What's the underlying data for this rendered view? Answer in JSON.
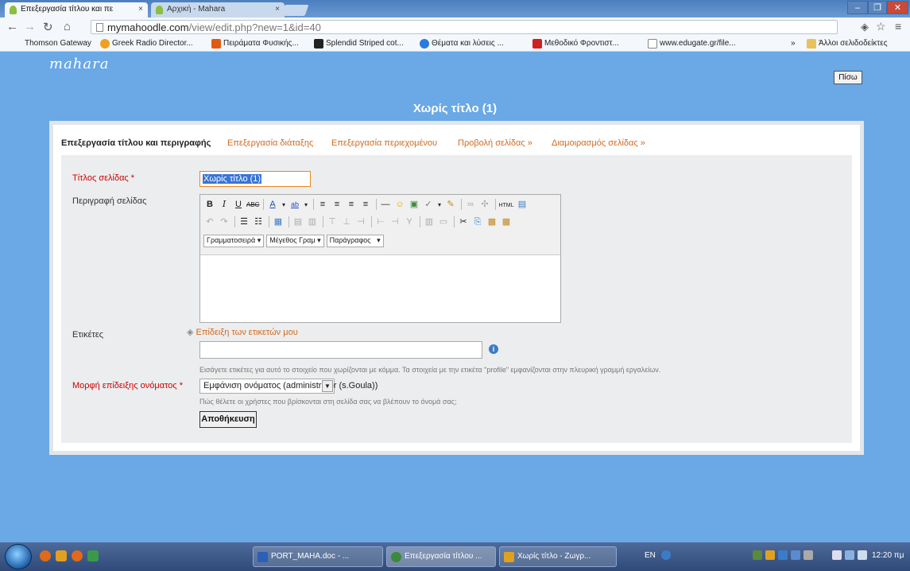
{
  "browser": {
    "tabs": [
      {
        "label": "Επεξεργασία τίτλου και πε",
        "active": true
      },
      {
        "label": "Αρχική - Mahara",
        "active": false
      }
    ],
    "close_glyph": "×",
    "url_host": "mymahoodle.com",
    "url_path": "/view/edit.php?new=1&id=40",
    "bookmarks": [
      {
        "label": "Thomson Gateway",
        "color": "#f4f7fb"
      },
      {
        "label": "Greek Radio Director...",
        "color": "#f0a020"
      },
      {
        "label": "Πειράματα Φυσικής...",
        "color": "#e05a12"
      },
      {
        "label": "Splendid Striped cot...",
        "color": "#222222"
      },
      {
        "label": "Θέματα και λύσεις ...",
        "color": "#2a7ae0"
      },
      {
        "label": "Μεθοδικό Φροντιστ...",
        "color": "#d02020"
      },
      {
        "label": "www.edugate.gr/file...",
        "color": "#ffffff"
      }
    ],
    "bookmarks_overflow": "»",
    "other_bookmarks": "Άλλοι σελιδοδείκτες"
  },
  "page": {
    "logo": "mahara",
    "back_label": "Πίσω",
    "title": "Χωρίς τίτλο (1)",
    "tabs": [
      {
        "label": "Επεξεργασία τίτλου και περιγραφής",
        "selected": true
      },
      {
        "label": "Επεξεργασία διάταξης",
        "selected": false
      },
      {
        "label": "Επεξεργασία περιεχομένου",
        "selected": false
      },
      {
        "label": "Προβολή σελίδας »",
        "selected": false
      },
      {
        "label": "Διαμοιρασμός σελίδας »",
        "selected": false
      }
    ],
    "form": {
      "title_label": "Τίτλος σελίδας *",
      "title_value": "Χωρίς τίτλο (1)",
      "description_label": "Περιγραφή σελίδας",
      "font_family_dropdown": "Γραμματοσειρά",
      "font_size_dropdown": "Μέγεθος Γραμ",
      "format_dropdown": "Παράγραφος",
      "tags_label": "Ετικέτες",
      "tags_toggle": "Επίδειξη των ετικετών μου",
      "tags_value": "",
      "tags_help": "Εισάγετε ετικέτες για αυτό το στοιχείο που χωρίζονται με κόμμα. Τα στοιχεία με την ετικέτα \"profile\" εμφανίζονται στην πλευρική γραμμή εργαλείων.",
      "name_display_label": "Μορφή επίδειξης ονόματος *",
      "name_display_value": "Εμφάνιση ονόματος (administrator (s.Goula))",
      "name_display_help": "Πώς θέλετε οι χρήστες που βρίσκονται στη σελίδα σας να βλέπουν το όνομά σας;",
      "save_label": "Αποθήκευση"
    }
  },
  "taskbar": {
    "tasks": [
      {
        "label": "PORT_MAHA.doc - ...",
        "color": "#2b5fb8"
      },
      {
        "label": "Επεξεργασία τίτλου ...",
        "color": "#3a8a3a"
      },
      {
        "label": "Χωρίς τίτλο - Ζωγρ...",
        "color": "#e0a020"
      }
    ],
    "language": "EN",
    "clock": "12:20 πμ"
  }
}
